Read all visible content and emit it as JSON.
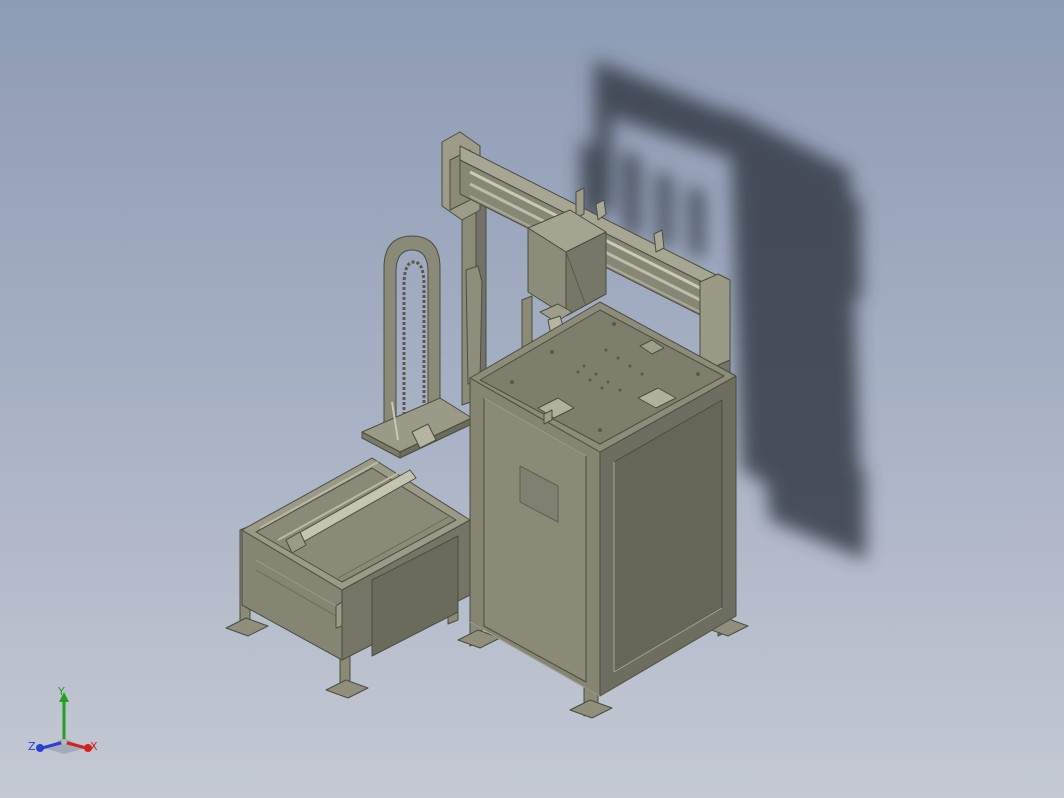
{
  "viewer": {
    "background_top": "#8d9bb4",
    "background_bottom": "#c4c9d3",
    "model_color": "#7c7c6a",
    "shadow_color": "#353c46"
  },
  "triad": {
    "x_label": "X",
    "y_label": "Y",
    "z_label": "Z",
    "x_color": "#d42020",
    "y_color": "#23a123",
    "z_color": "#2a3fd6"
  }
}
